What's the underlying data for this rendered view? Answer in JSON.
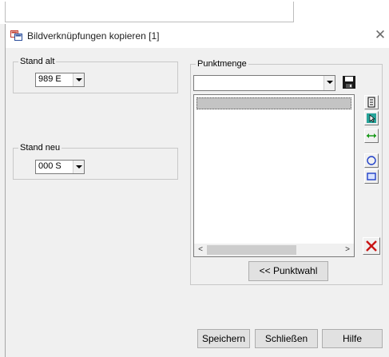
{
  "window": {
    "title": "Bildverknüpfungen kopieren [1]",
    "close_symbol": "✕"
  },
  "stand_alt": {
    "label": "Stand alt",
    "value": "989  E"
  },
  "stand_neu": {
    "label": "Stand neu",
    "value": "000  S"
  },
  "punktmenge": {
    "label": "Punktmenge",
    "combo_value": "",
    "list_items": [
      ""
    ],
    "scroll_left": "<",
    "scroll_right": ">"
  },
  "tools": [
    "clipboard-icon",
    "pointer-select-icon",
    "horizontal-arrow-icon",
    "circle-icon",
    "rectangle-icon",
    "delete-x-icon"
  ],
  "buttons": {
    "punktwahl": "<< Punktwahl",
    "speichern": "Speichern",
    "schliessen": "Schließen",
    "hilfe": "Hilfe"
  }
}
